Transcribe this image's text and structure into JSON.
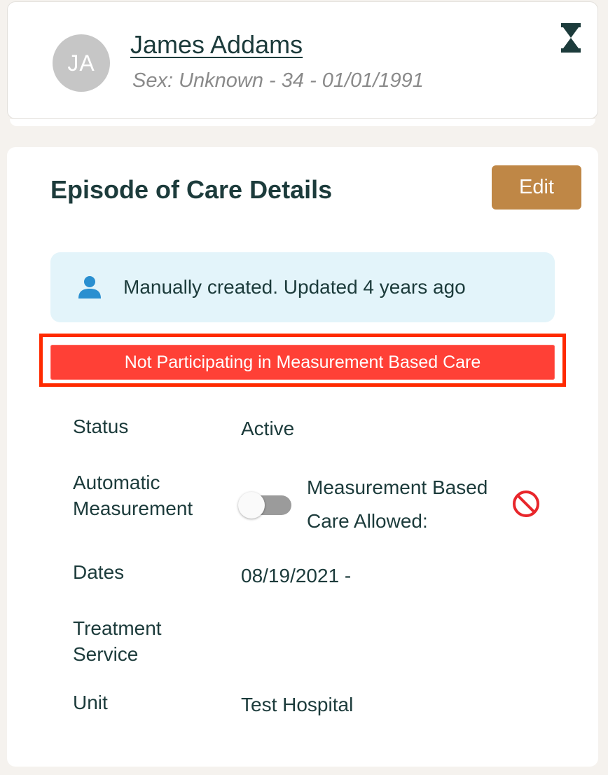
{
  "patient": {
    "initials": "JA",
    "name": "James Addams",
    "meta": "Sex: Unknown - 34 - 01/01/1991"
  },
  "icons": {
    "timer": "hourglass-icon",
    "creator": "person-icon",
    "mbc_disallowed": "no-entry-icon"
  },
  "episode": {
    "title": "Episode of Care Details",
    "edit_label": "Edit",
    "source_text": "Manually created. Updated 4 years ago",
    "mbc_alert": "Not Participating in Measurement Based Care",
    "fields": {
      "status_label": "Status",
      "status_value": "Active",
      "auto_measure_label_1": "Automatic",
      "auto_measure_label_2": "Measurement",
      "auto_measure_on": false,
      "mbc_allowed_label": "Measurement Based Care Allowed:",
      "dates_label": "Dates",
      "dates_value": "08/19/2021 -",
      "treatment_label_1": "Treatment",
      "treatment_label_2": "Service",
      "treatment_value": "",
      "unit_label": "Unit",
      "unit_value": "Test Hospital"
    }
  },
  "colors": {
    "primary_text": "#1c3b3b",
    "edit_button": "#bf8746",
    "alert_red": "#ff4036",
    "highlight": "#ff2a00",
    "banner_bg": "#e3f4fa",
    "icon_blue": "#2a8fd0"
  }
}
